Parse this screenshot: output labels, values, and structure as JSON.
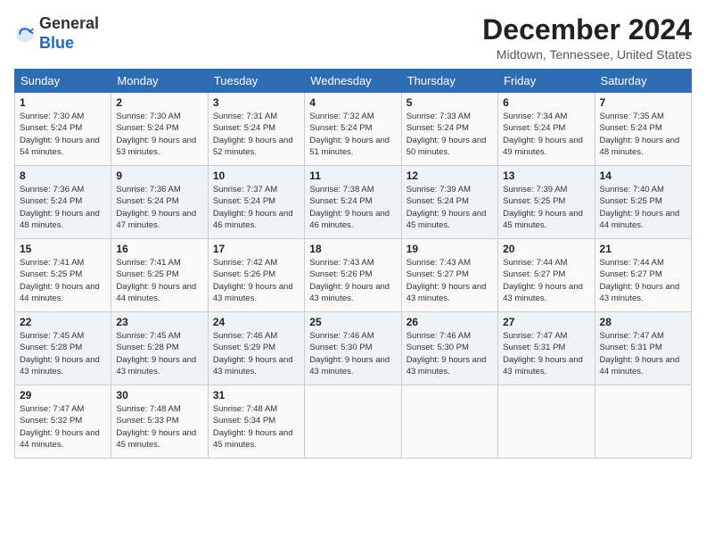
{
  "header": {
    "logo_general": "General",
    "logo_blue": "Blue",
    "month_title": "December 2024",
    "location": "Midtown, Tennessee, United States"
  },
  "days_of_week": [
    "Sunday",
    "Monday",
    "Tuesday",
    "Wednesday",
    "Thursday",
    "Friday",
    "Saturday"
  ],
  "weeks": [
    [
      {
        "day": "1",
        "sunrise": "7:30 AM",
        "sunset": "5:24 PM",
        "daylight": "9 hours and 54 minutes."
      },
      {
        "day": "2",
        "sunrise": "7:30 AM",
        "sunset": "5:24 PM",
        "daylight": "9 hours and 53 minutes."
      },
      {
        "day": "3",
        "sunrise": "7:31 AM",
        "sunset": "5:24 PM",
        "daylight": "9 hours and 52 minutes."
      },
      {
        "day": "4",
        "sunrise": "7:32 AM",
        "sunset": "5:24 PM",
        "daylight": "9 hours and 51 minutes."
      },
      {
        "day": "5",
        "sunrise": "7:33 AM",
        "sunset": "5:24 PM",
        "daylight": "9 hours and 50 minutes."
      },
      {
        "day": "6",
        "sunrise": "7:34 AM",
        "sunset": "5:24 PM",
        "daylight": "9 hours and 49 minutes."
      },
      {
        "day": "7",
        "sunrise": "7:35 AM",
        "sunset": "5:24 PM",
        "daylight": "9 hours and 48 minutes."
      }
    ],
    [
      {
        "day": "8",
        "sunrise": "7:36 AM",
        "sunset": "5:24 PM",
        "daylight": "9 hours and 48 minutes."
      },
      {
        "day": "9",
        "sunrise": "7:36 AM",
        "sunset": "5:24 PM",
        "daylight": "9 hours and 47 minutes."
      },
      {
        "day": "10",
        "sunrise": "7:37 AM",
        "sunset": "5:24 PM",
        "daylight": "9 hours and 46 minutes."
      },
      {
        "day": "11",
        "sunrise": "7:38 AM",
        "sunset": "5:24 PM",
        "daylight": "9 hours and 46 minutes."
      },
      {
        "day": "12",
        "sunrise": "7:39 AM",
        "sunset": "5:24 PM",
        "daylight": "9 hours and 45 minutes."
      },
      {
        "day": "13",
        "sunrise": "7:39 AM",
        "sunset": "5:25 PM",
        "daylight": "9 hours and 45 minutes."
      },
      {
        "day": "14",
        "sunrise": "7:40 AM",
        "sunset": "5:25 PM",
        "daylight": "9 hours and 44 minutes."
      }
    ],
    [
      {
        "day": "15",
        "sunrise": "7:41 AM",
        "sunset": "5:25 PM",
        "daylight": "9 hours and 44 minutes."
      },
      {
        "day": "16",
        "sunrise": "7:41 AM",
        "sunset": "5:25 PM",
        "daylight": "9 hours and 44 minutes."
      },
      {
        "day": "17",
        "sunrise": "7:42 AM",
        "sunset": "5:26 PM",
        "daylight": "9 hours and 43 minutes."
      },
      {
        "day": "18",
        "sunrise": "7:43 AM",
        "sunset": "5:26 PM",
        "daylight": "9 hours and 43 minutes."
      },
      {
        "day": "19",
        "sunrise": "7:43 AM",
        "sunset": "5:27 PM",
        "daylight": "9 hours and 43 minutes."
      },
      {
        "day": "20",
        "sunrise": "7:44 AM",
        "sunset": "5:27 PM",
        "daylight": "9 hours and 43 minutes."
      },
      {
        "day": "21",
        "sunrise": "7:44 AM",
        "sunset": "5:27 PM",
        "daylight": "9 hours and 43 minutes."
      }
    ],
    [
      {
        "day": "22",
        "sunrise": "7:45 AM",
        "sunset": "5:28 PM",
        "daylight": "9 hours and 43 minutes."
      },
      {
        "day": "23",
        "sunrise": "7:45 AM",
        "sunset": "5:28 PM",
        "daylight": "9 hours and 43 minutes."
      },
      {
        "day": "24",
        "sunrise": "7:46 AM",
        "sunset": "5:29 PM",
        "daylight": "9 hours and 43 minutes."
      },
      {
        "day": "25",
        "sunrise": "7:46 AM",
        "sunset": "5:30 PM",
        "daylight": "9 hours and 43 minutes."
      },
      {
        "day": "26",
        "sunrise": "7:46 AM",
        "sunset": "5:30 PM",
        "daylight": "9 hours and 43 minutes."
      },
      {
        "day": "27",
        "sunrise": "7:47 AM",
        "sunset": "5:31 PM",
        "daylight": "9 hours and 43 minutes."
      },
      {
        "day": "28",
        "sunrise": "7:47 AM",
        "sunset": "5:31 PM",
        "daylight": "9 hours and 44 minutes."
      }
    ],
    [
      {
        "day": "29",
        "sunrise": "7:47 AM",
        "sunset": "5:32 PM",
        "daylight": "9 hours and 44 minutes."
      },
      {
        "day": "30",
        "sunrise": "7:48 AM",
        "sunset": "5:33 PM",
        "daylight": "9 hours and 45 minutes."
      },
      {
        "day": "31",
        "sunrise": "7:48 AM",
        "sunset": "5:34 PM",
        "daylight": "9 hours and 45 minutes."
      },
      null,
      null,
      null,
      null
    ]
  ]
}
